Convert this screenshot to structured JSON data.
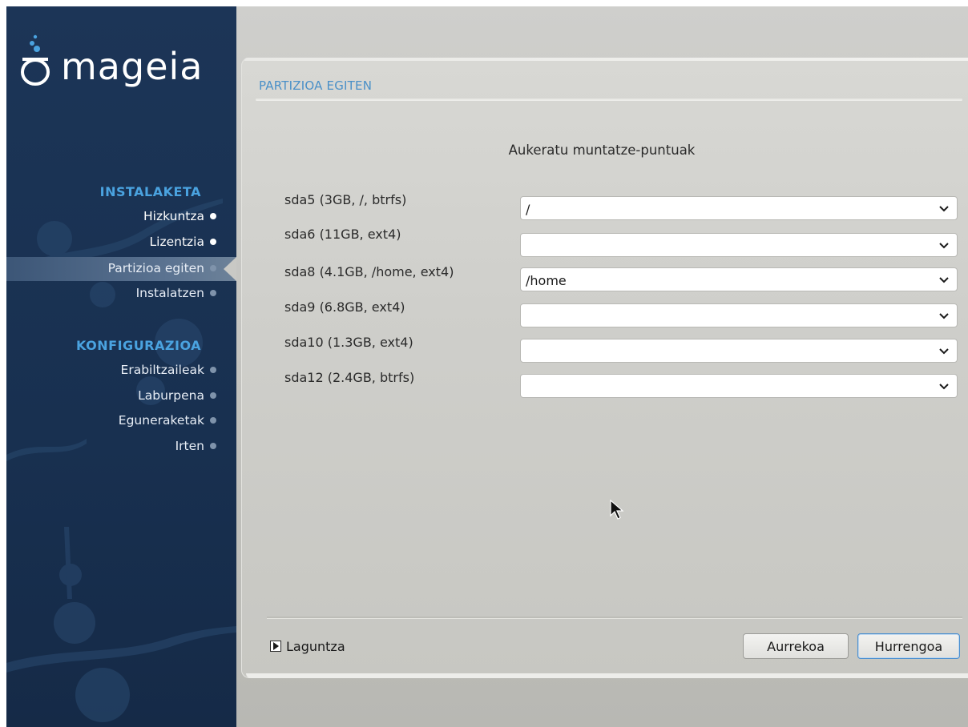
{
  "app": {
    "logo_text": "mageia"
  },
  "sidebar": {
    "sections": [
      {
        "title": "INSTALAKETA",
        "items": [
          {
            "label": "Hizkuntza",
            "state": "done"
          },
          {
            "label": "Lizentzia",
            "state": "done"
          },
          {
            "label": "Partizioa egiten",
            "state": "active"
          },
          {
            "label": "Instalatzen",
            "state": "pending"
          }
        ]
      },
      {
        "title": "KONFIGURAZIOA",
        "items": [
          {
            "label": "Erabiltzaileak",
            "state": "pending"
          },
          {
            "label": "Laburpena",
            "state": "pending"
          },
          {
            "label": "Eguneraketak",
            "state": "pending"
          },
          {
            "label": "Irten",
            "state": "pending"
          }
        ]
      }
    ]
  },
  "main": {
    "step_title": "PARTIZIOA EGITEN",
    "heading": "Aukeratu muntatze-puntuak",
    "rows": [
      {
        "label": "sda5 (3GB, /, btrfs)",
        "value": "/"
      },
      {
        "label": "sda6 (11GB, ext4)",
        "value": ""
      },
      {
        "label": "sda8 (4.1GB, /home, ext4)",
        "value": "/home"
      },
      {
        "label": "sda9 (6.8GB, ext4)",
        "value": ""
      },
      {
        "label": "sda10 (1.3GB, ext4)",
        "value": ""
      },
      {
        "label": "sda12 (2.4GB, btrfs)",
        "value": ""
      }
    ],
    "help_label": "Laguntza",
    "prev_label": "Aurrekoa",
    "next_label": "Hurrengoa"
  },
  "colors": {
    "sidebar_bg": "#1c3557",
    "section_title": "#4aa3e0",
    "step_title": "#4a90c8",
    "next_button_border": "#4a8fd0"
  },
  "icons": {
    "logo": "mageia-cauldron-icon",
    "combo": "chevron-down-icon",
    "help": "expander-triangle-icon",
    "cursor": "mouse-pointer-icon"
  }
}
